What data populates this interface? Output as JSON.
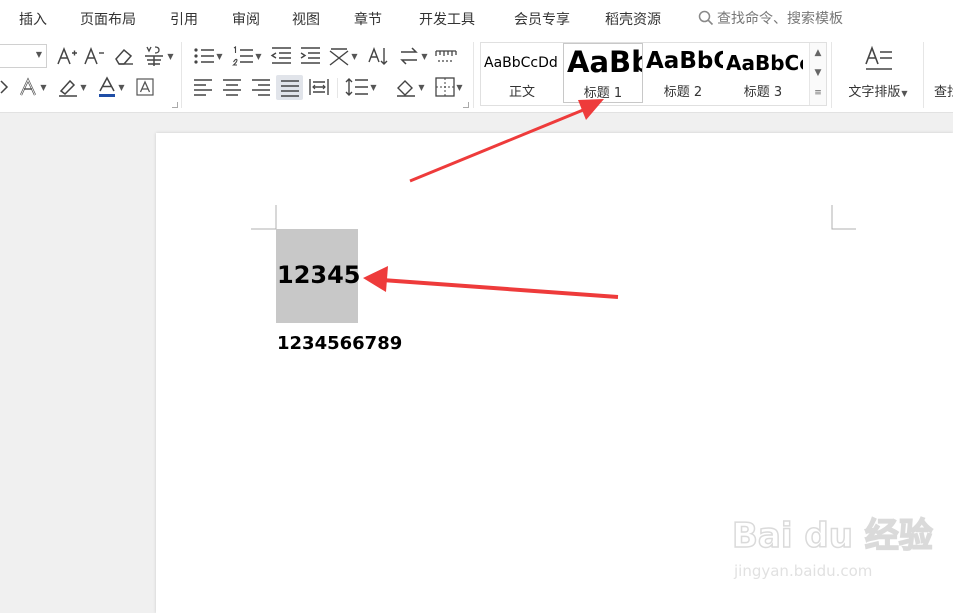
{
  "menu": {
    "items": [
      "插入",
      "页面布局",
      "引用",
      "审阅",
      "视图",
      "章节",
      "开发工具",
      "会员专享",
      "稻壳资源"
    ],
    "search_placeholder": "查找命令、搜索模板"
  },
  "ribbon": {
    "styles": [
      {
        "sample": "AaBbCcDd",
        "name": "正文"
      },
      {
        "sample": "AaBb",
        "name": "标题 1"
      },
      {
        "sample": "AaBbC",
        "name": "标题 2"
      },
      {
        "sample": "AaBbCc",
        "name": "标题 3"
      }
    ],
    "text_layout": "文字排版",
    "find": "查找"
  },
  "document": {
    "heading": "12345",
    "body": "1234566789"
  },
  "watermark": {
    "logo": "Bai du 经验",
    "site": "jingyan.baidu.com"
  },
  "colors": {
    "accent_arrow": "#ee3b3b",
    "selection": "#c8c8c8",
    "font_color_bar": "#1f4ea6"
  }
}
